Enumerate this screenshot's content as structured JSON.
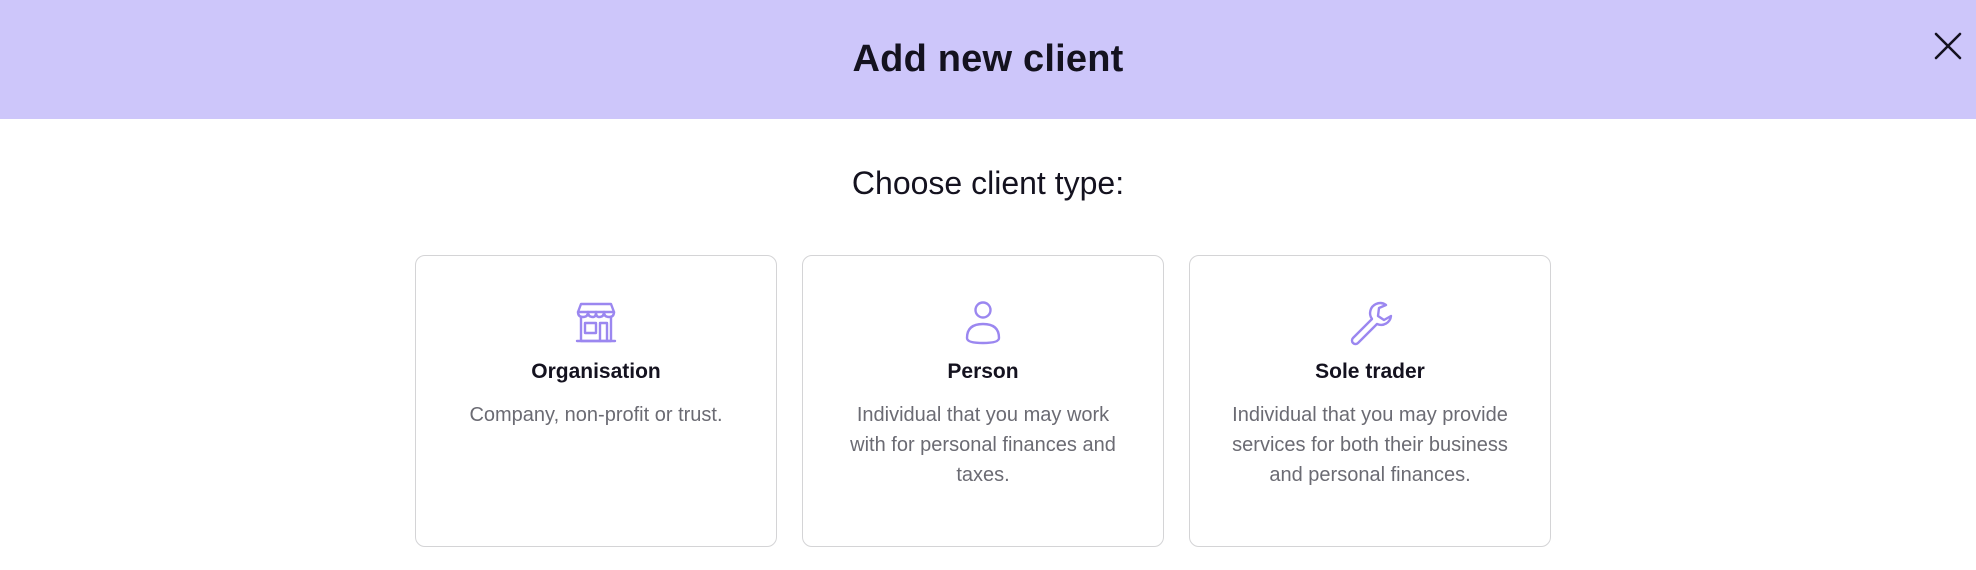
{
  "dialog": {
    "title": "Add new client",
    "close_icon": "close-icon"
  },
  "prompt": "Choose client type:",
  "accent_color": "#cdc6fa",
  "icon_color": "#9b87f0",
  "client_types": [
    {
      "icon": "storefront-icon",
      "title": "Organisation",
      "description": "Company, non-profit or trust."
    },
    {
      "icon": "person-icon",
      "title": "Person",
      "description": "Individual that you may work with for personal finances and taxes."
    },
    {
      "icon": "wrench-icon",
      "title": "Sole trader",
      "description": "Individual that you may provide services for both their business and personal finances."
    }
  ]
}
